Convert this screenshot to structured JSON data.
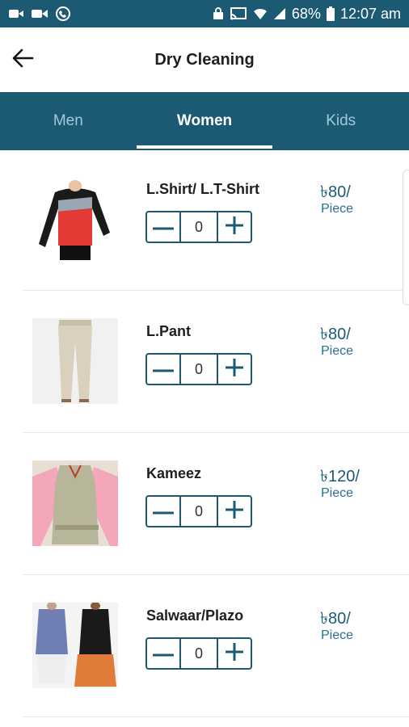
{
  "status_bar": {
    "battery": "68%",
    "time": "12:07 am",
    "icons": [
      "video-icon",
      "camera-icon",
      "phone-icon",
      "lock-icon",
      "cast-icon",
      "wifi-icon",
      "signal-icon",
      "battery-icon"
    ]
  },
  "header": {
    "title": "Dry Cleaning",
    "back_icon": "arrow-left-icon"
  },
  "tabs": [
    {
      "label": "Men",
      "active": false
    },
    {
      "label": "Women",
      "active": true
    },
    {
      "label": "Kids",
      "active": false
    }
  ],
  "items": [
    {
      "name": "L.Shirt/ L.T-Shirt",
      "qty": "0",
      "price": "৳80/",
      "unit": "Piece",
      "image": "women-shirt-image"
    },
    {
      "name": "L.Pant",
      "qty": "0",
      "price": "৳80/",
      "unit": "Piece",
      "image": "women-pant-image"
    },
    {
      "name": "Kameez",
      "qty": "0",
      "price": "৳120/",
      "unit": "Piece",
      "image": "kameez-image"
    },
    {
      "name": "Salwaar/Plazo",
      "qty": "0",
      "price": "৳80/",
      "unit": "Piece",
      "image": "salwaar-image"
    }
  ],
  "colors": {
    "primary": "#1c5a74",
    "tab_inactive": "#9fc9df",
    "white": "#ffffff"
  }
}
